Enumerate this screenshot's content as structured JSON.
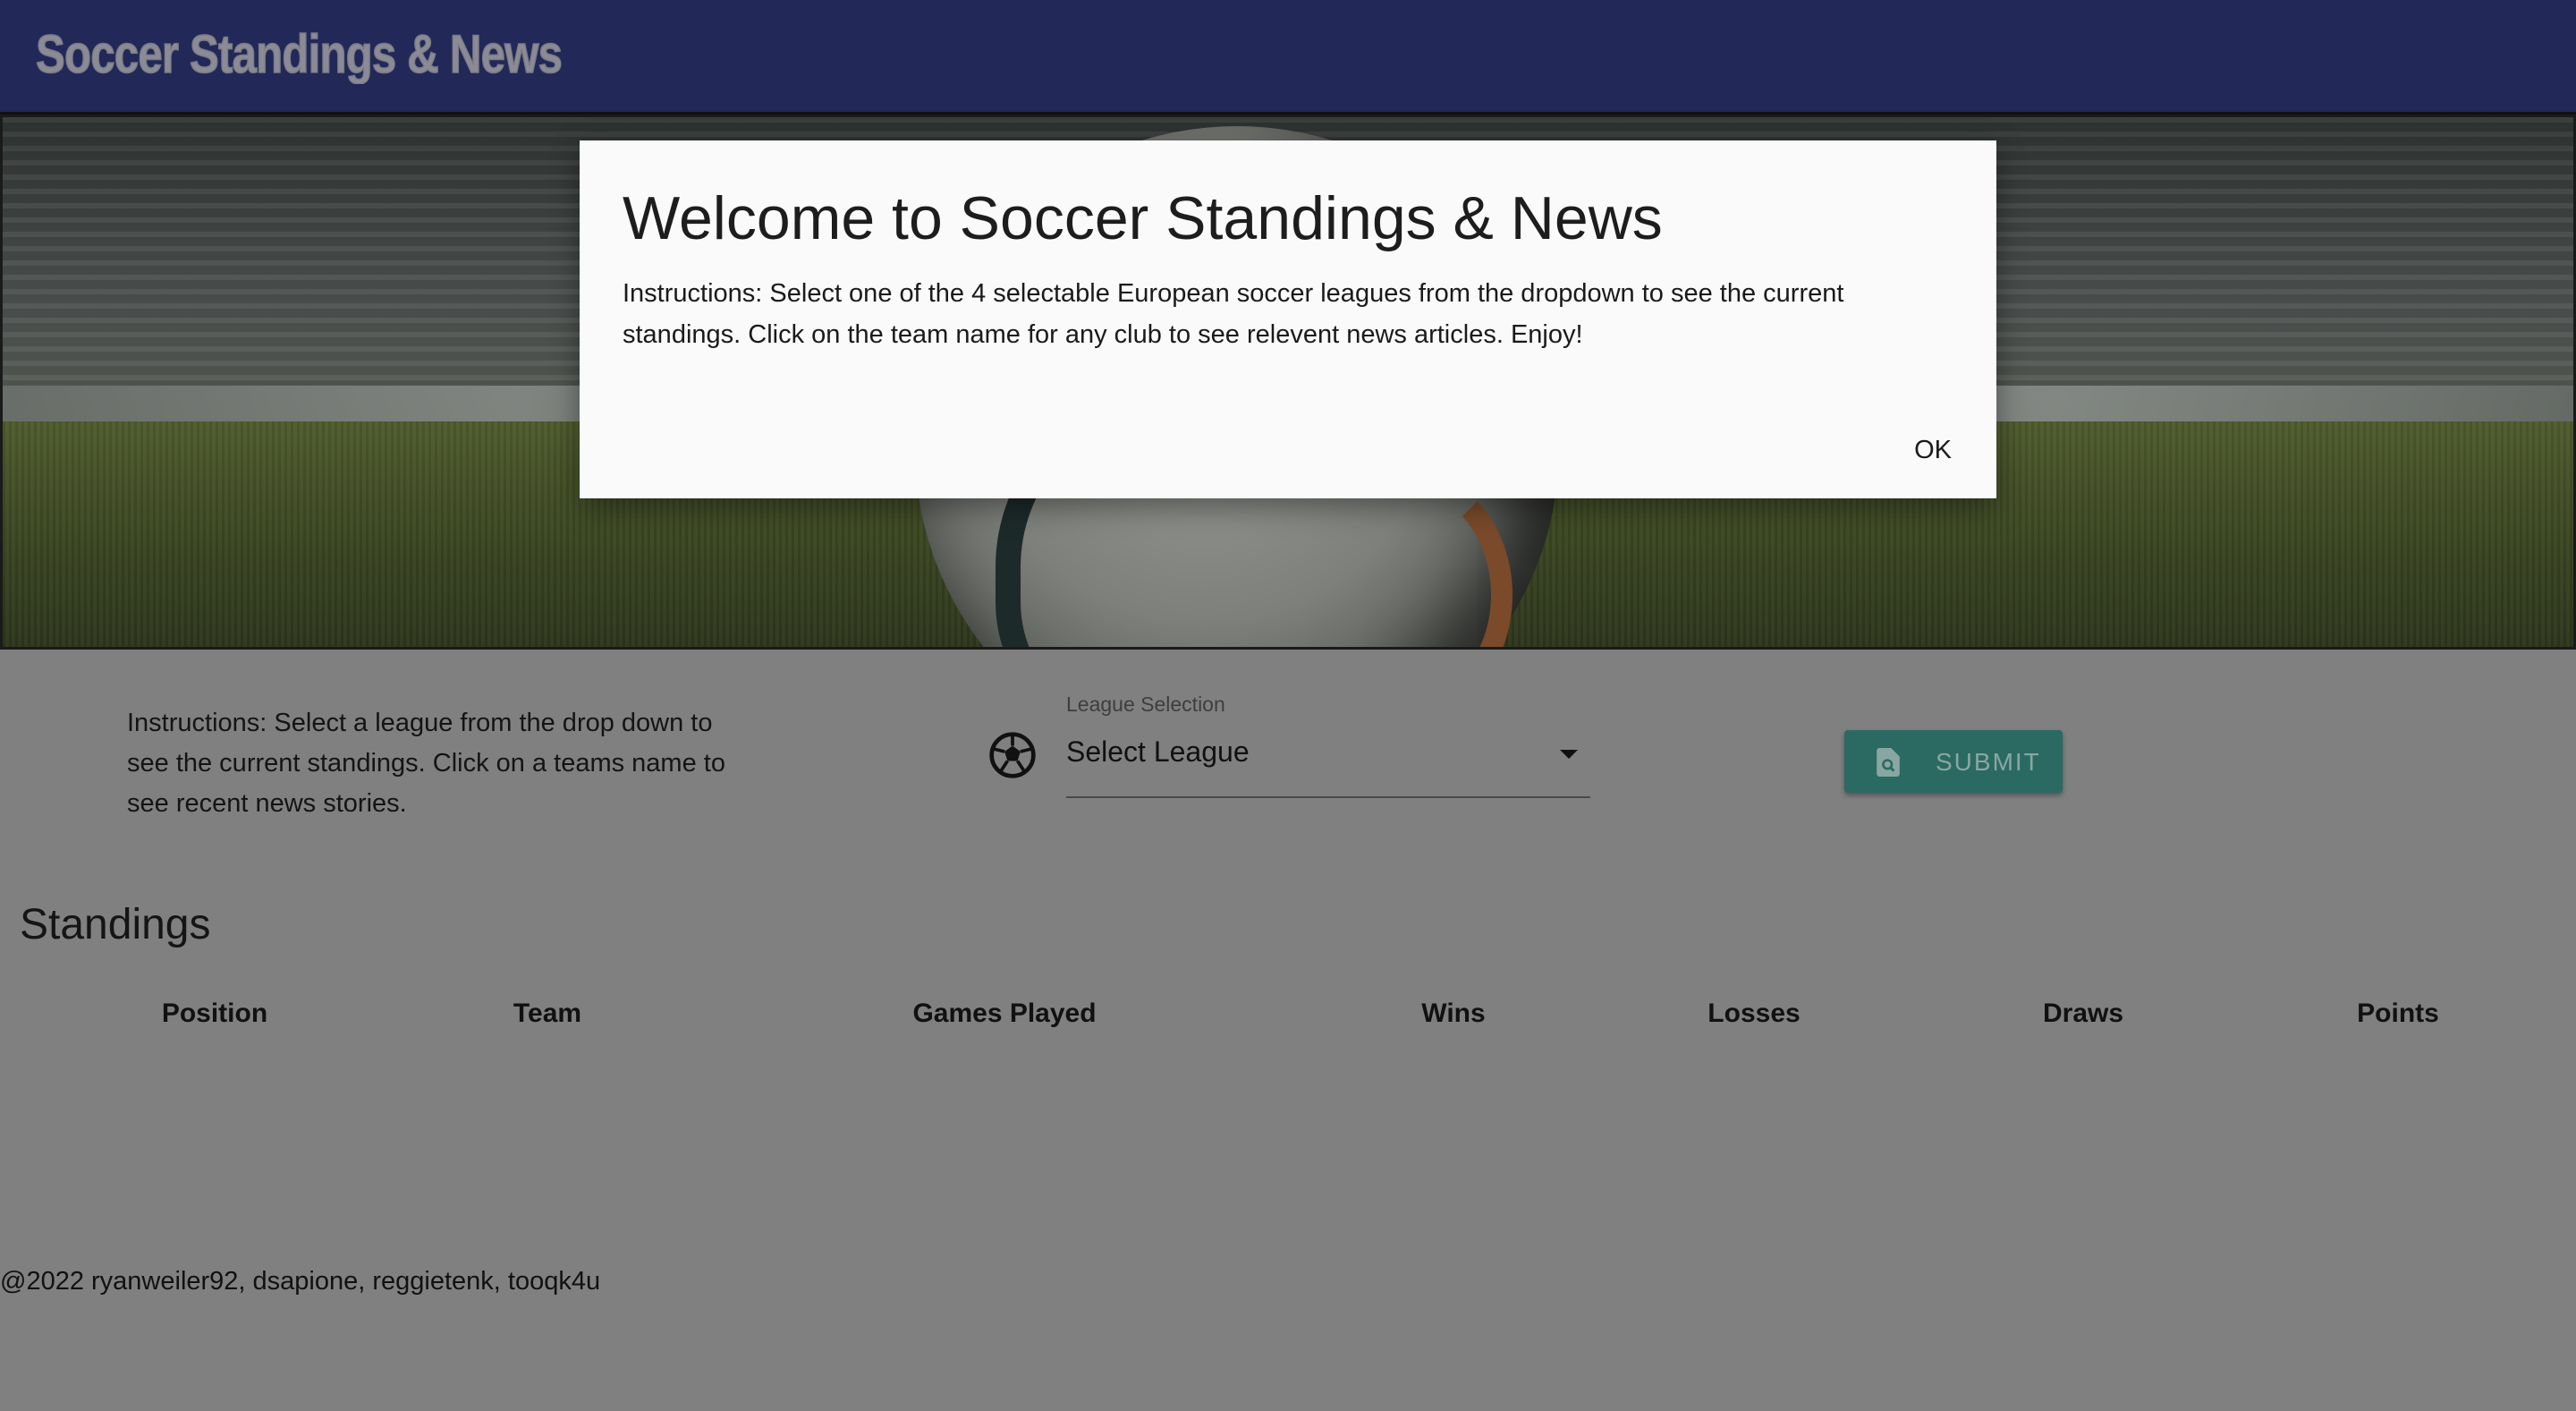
{
  "header": {
    "title": "Soccer Standings & News"
  },
  "controls": {
    "instructions": "Instructions: Select a league from the drop down to see the current standings. Click on a teams name to see recent news stories.",
    "league_label": "League Selection",
    "league_value": "Select League",
    "submit_label": "SUBMIT"
  },
  "standings": {
    "title": "Standings",
    "columns": [
      "Position",
      "Team",
      "Games Played",
      "Wins",
      "Losses",
      "Draws",
      "Points"
    ]
  },
  "footer": {
    "text": "@2022 ryanweiler92, dsapione, reggietenk, tooqk4u"
  },
  "modal": {
    "title": "Welcome to Soccer Standings & News",
    "body": "Instructions: Select one of the 4 selectable European soccer leagues from the dropdown to see the current standings. Click on the team name for any club to see relevent news articles. Enjoy!",
    "ok_label": "OK"
  },
  "icons": {
    "league": "soccer-ball-icon",
    "submit": "search-document-icon"
  },
  "colors": {
    "header_bg": "#222959",
    "submit_bg": "#2a6a62",
    "page_overlay": "#808080"
  }
}
